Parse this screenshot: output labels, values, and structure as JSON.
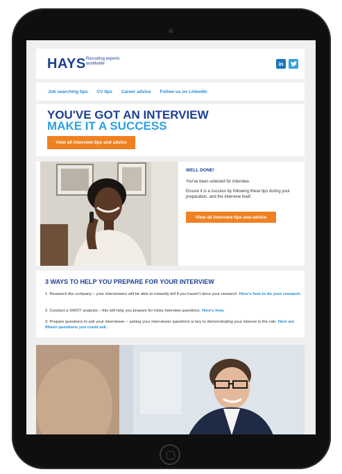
{
  "header": {
    "logo": "HAYS",
    "tagline": "Recruiting experts worldwide",
    "social_linkedin": "in",
    "social_twitter": "t"
  },
  "nav": {
    "items": [
      "Job searching tips",
      "CV tips",
      "Career advice",
      "Follow us on LinkedIn"
    ]
  },
  "hero": {
    "title_line1": "YOU'VE GOT AN INTERVIEW",
    "title_line2": "MAKE IT A SUCCESS",
    "button": "View all interview tips and advice"
  },
  "well_done": {
    "heading": "WELL DONE!",
    "para1": "You've been selected for interview.",
    "para2": "Ensure it is a success by following these tips during your preparation, and the interview itself.",
    "button": "View all interview tips and advice"
  },
  "ways": {
    "title": "3 WAYS TO HELP YOU PREPARE FOR YOUR INTERVIEW",
    "item1_text": "1. Research the company – your interviewers will be able to instantly tell if you haven't done your research. ",
    "item1_link": "Here's how to do your research.",
    "item2_text": "2. Conduct a SWOT analysis – this will help you prepare for tricky interview questions. ",
    "item2_link": "Here's how.",
    "item3_text": "3. Prepare questions to ask your interviewer – asking your interviewer questions is key to demonstrating your interest in the role. ",
    "item3_link": "Here are fifteen questions you could ask."
  },
  "colors": {
    "brand_navy": "#1c3f94",
    "brand_blue": "#2aa0df",
    "link_blue": "#1e8bd6",
    "cta_orange": "#f08122"
  }
}
